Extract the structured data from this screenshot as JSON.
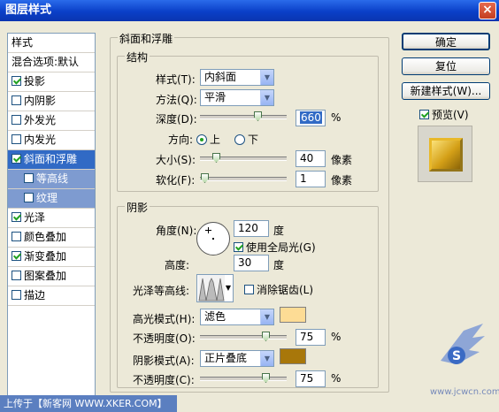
{
  "window": {
    "title": "图层样式",
    "close_glyph": "×"
  },
  "styles_list": {
    "items": [
      {
        "label": "样式",
        "type": "header"
      },
      {
        "label": "混合选项:默认",
        "type": "header"
      },
      {
        "label": "投影",
        "checked": true
      },
      {
        "label": "内阴影",
        "checked": false
      },
      {
        "label": "外发光",
        "checked": false
      },
      {
        "label": "内发光",
        "checked": false
      },
      {
        "label": "斜面和浮雕",
        "checked": true,
        "selected": true
      },
      {
        "label": "等高线",
        "checked": false,
        "sub": true
      },
      {
        "label": "纹理",
        "checked": false,
        "sub": true
      },
      {
        "label": "光泽",
        "checked": true
      },
      {
        "label": "颜色叠加",
        "checked": false
      },
      {
        "label": "渐变叠加",
        "checked": true
      },
      {
        "label": "图案叠加",
        "checked": false
      },
      {
        "label": "描边",
        "checked": false
      }
    ]
  },
  "bevel": {
    "section_title": "斜面和浮雕",
    "structure": {
      "title": "结构",
      "style_label": "样式(T):",
      "style_value": "内斜面",
      "technique_label": "方法(Q):",
      "technique_value": "平滑",
      "depth_label": "深度(D):",
      "depth_value": "660",
      "depth_unit": "%",
      "depth_pct": 0.66,
      "direction_label": "方向:",
      "dir_up": "上",
      "dir_down": "下",
      "size_label": "大小(S):",
      "size_value": "40",
      "size_unit": "像素",
      "soften_label": "软化(F):",
      "soften_value": "1",
      "soften_unit": "像素"
    },
    "shading": {
      "title": "阴影",
      "angle_label": "角度(N):",
      "angle_value": "120",
      "angle_unit": "度",
      "global_light_label": "使用全局光(G)",
      "altitude_label": "高度:",
      "altitude_value": "30",
      "altitude_unit": "度",
      "gloss_label": "光泽等高线:",
      "antialias_label": "消除锯齿(L)",
      "highlight_mode_label": "高光模式(H):",
      "highlight_mode_value": "滤色",
      "highlight_color": "#fddc95",
      "highlight_opacity_label": "不透明度(O):",
      "highlight_opacity_value": "75",
      "highlight_opacity_unit": "%",
      "shadow_mode_label": "阴影模式(A):",
      "shadow_mode_value": "正片叠底",
      "shadow_color": "#a8770a",
      "shadow_opacity_label": "不透明度(C):",
      "shadow_opacity_value": "75",
      "shadow_opacity_unit": "%"
    }
  },
  "buttons": {
    "ok": "确定",
    "reset": "复位",
    "new_style": "新建样式(W)...",
    "preview_label": "预览(V)"
  },
  "watermark": {
    "footer_text": "上传于【新客网 WWW.XKER.COM】",
    "site_text": "www.jcwcn.com"
  }
}
